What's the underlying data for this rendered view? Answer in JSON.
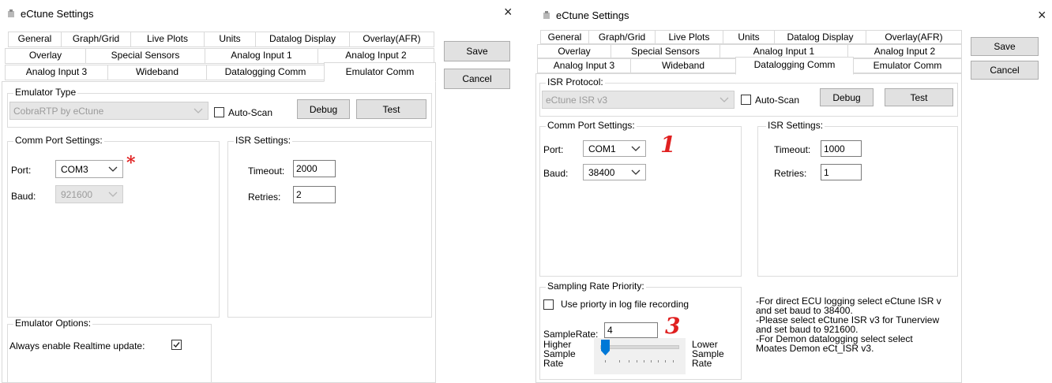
{
  "left_window": {
    "title": "eCtune Settings",
    "close_glyph": "×",
    "tabs_row1": [
      "General",
      "Graph/Grid",
      "Live Plots",
      "Units",
      "Datalog Display",
      "Overlay(AFR)"
    ],
    "tabs_row2": [
      "Overlay",
      "Special Sensors",
      "Analog Input 1",
      "Analog Input 2"
    ],
    "tabs_row3": [
      "Analog Input 3",
      "Wideband",
      "Datalogging Comm",
      "Emulator Comm"
    ],
    "selected_tab": "Emulator Comm",
    "save_label": "Save",
    "cancel_label": "Cancel",
    "emulator_type": {
      "group_label": "Emulator Type",
      "selected": "CobraRTP by eCtune",
      "auto_scan_label": "Auto-Scan",
      "auto_scan_checked": false,
      "debug_label": "Debug",
      "test_label": "Test"
    },
    "comm_port": {
      "group_label": "Comm Port Settings:",
      "port_label": "Port:",
      "port_value": "COM3",
      "baud_label": "Baud:",
      "baud_value": "921600",
      "annotation": "*"
    },
    "isr_settings": {
      "group_label": "ISR Settings:",
      "timeout_label": "Timeout:",
      "timeout_value": "2000",
      "retries_label": "Retries:",
      "retries_value": "2"
    },
    "emulator_options": {
      "group_label": "Emulator Options:",
      "realtime_label": "Always enable Realtime update:",
      "realtime_checked": true
    }
  },
  "right_window": {
    "title": "eCtune Settings",
    "close_glyph": "×",
    "tabs_row1": [
      "General",
      "Graph/Grid",
      "Live Plots",
      "Units",
      "Datalog Display",
      "Overlay(AFR)"
    ],
    "tabs_row2": [
      "Overlay",
      "Special Sensors",
      "Analog Input 1",
      "Analog Input 2"
    ],
    "tabs_row3": [
      "Analog Input 3",
      "Wideband",
      "Datalogging Comm",
      "Emulator Comm"
    ],
    "selected_tab": "Datalogging Comm",
    "save_label": "Save",
    "cancel_label": "Cancel",
    "isr_protocol": {
      "group_label": "ISR Protocol:",
      "selected": "eCtune ISR v3",
      "auto_scan_label": "Auto-Scan",
      "auto_scan_checked": false,
      "debug_label": "Debug",
      "test_label": "Test"
    },
    "comm_port": {
      "group_label": "Comm Port Settings:",
      "port_label": "Port:",
      "port_value": "COM1",
      "baud_label": "Baud:",
      "baud_value": "38400",
      "annotation": "1"
    },
    "isr_settings": {
      "group_label": "ISR Settings:",
      "timeout_label": "Timeout:",
      "timeout_value": "1000",
      "retries_label": "Retries:",
      "retries_value": "1"
    },
    "sampling": {
      "group_label": "Sampling Rate Priority:",
      "use_priority_label": "Use priorty in log file recording",
      "use_priority_checked": false,
      "samplerate_label": "SampleRate:",
      "samplerate_value": "4",
      "annotation": "3",
      "higher_label": "Higher\nSample\nRate",
      "lower_label": "Lower\nSample\nRate"
    },
    "notes": "-For direct ECU logging select eCtune ISR v\nand set baud to 38400.\n-Please select eCtune ISR v3 for Tunerview\nand set baud to 921600.\n-For Demon datalogging select select\nMoates Demon eCt_ISR v3."
  }
}
